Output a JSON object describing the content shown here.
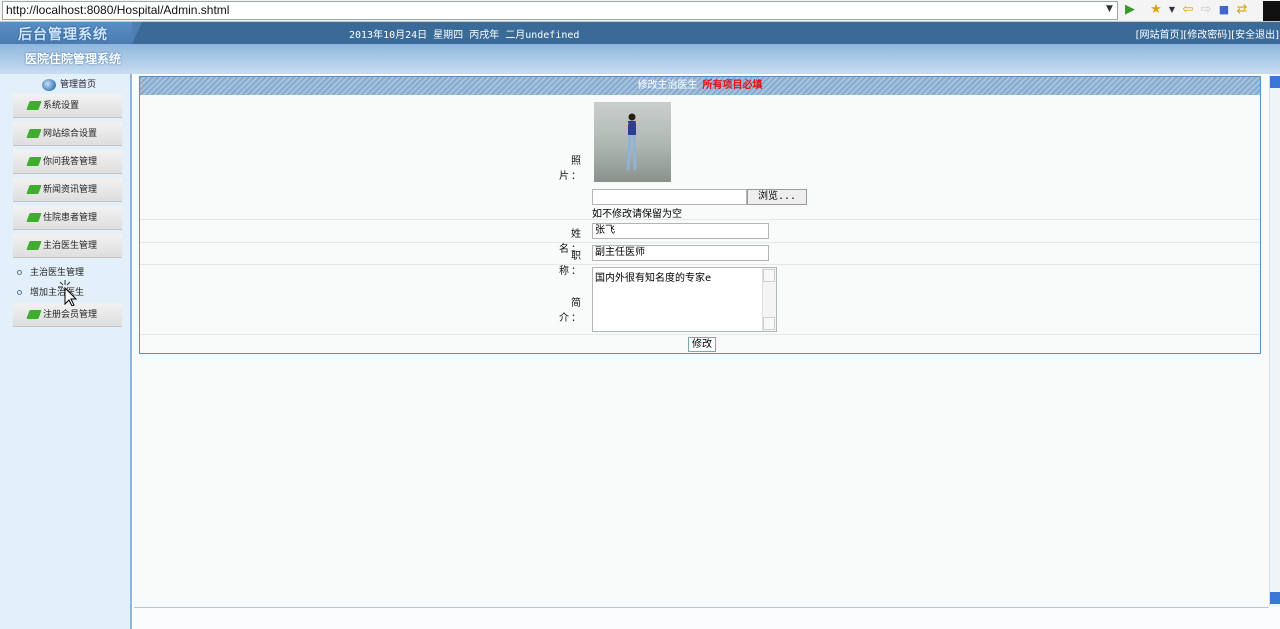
{
  "browser": {
    "url": "http://localhost:8080/Hospital/Admin.shtml"
  },
  "header": {
    "admin_logo": "后台管理系统",
    "date": "2013年10月24日 星期四 丙戌年 二月undefined",
    "links": {
      "home": "[网站首页]",
      "change_password": "[修改密码]",
      "logout": "[安全退出]"
    }
  },
  "title": "医院住院管理系统",
  "sidebar": {
    "home": "管理首页",
    "items_top": [
      {
        "label": "系统设置"
      },
      {
        "label": "网站综合设置"
      },
      {
        "label": "你问我答管理"
      },
      {
        "label": "新闻资讯管理"
      },
      {
        "label": "住院患者管理"
      },
      {
        "label": "主治医生管理"
      }
    ],
    "sub_items": [
      {
        "label": "主治医生管理"
      },
      {
        "label": "增加主治医生"
      }
    ],
    "items_bottom": [
      {
        "label": "注册会员管理"
      }
    ]
  },
  "form": {
    "header": "修改主治医生",
    "required_note": "所有项目必填",
    "photo_label": "照　片：",
    "browse_label": "浏览...",
    "photo_hint": "如不修改请保留为空",
    "name_label": "姓　名：",
    "name_value": "张飞",
    "title_label": "职　称：",
    "title_value": "副主任医师",
    "intro_label": "简　介：",
    "intro_value": "国内外很有知名度的专家e",
    "submit_label": "修改"
  }
}
